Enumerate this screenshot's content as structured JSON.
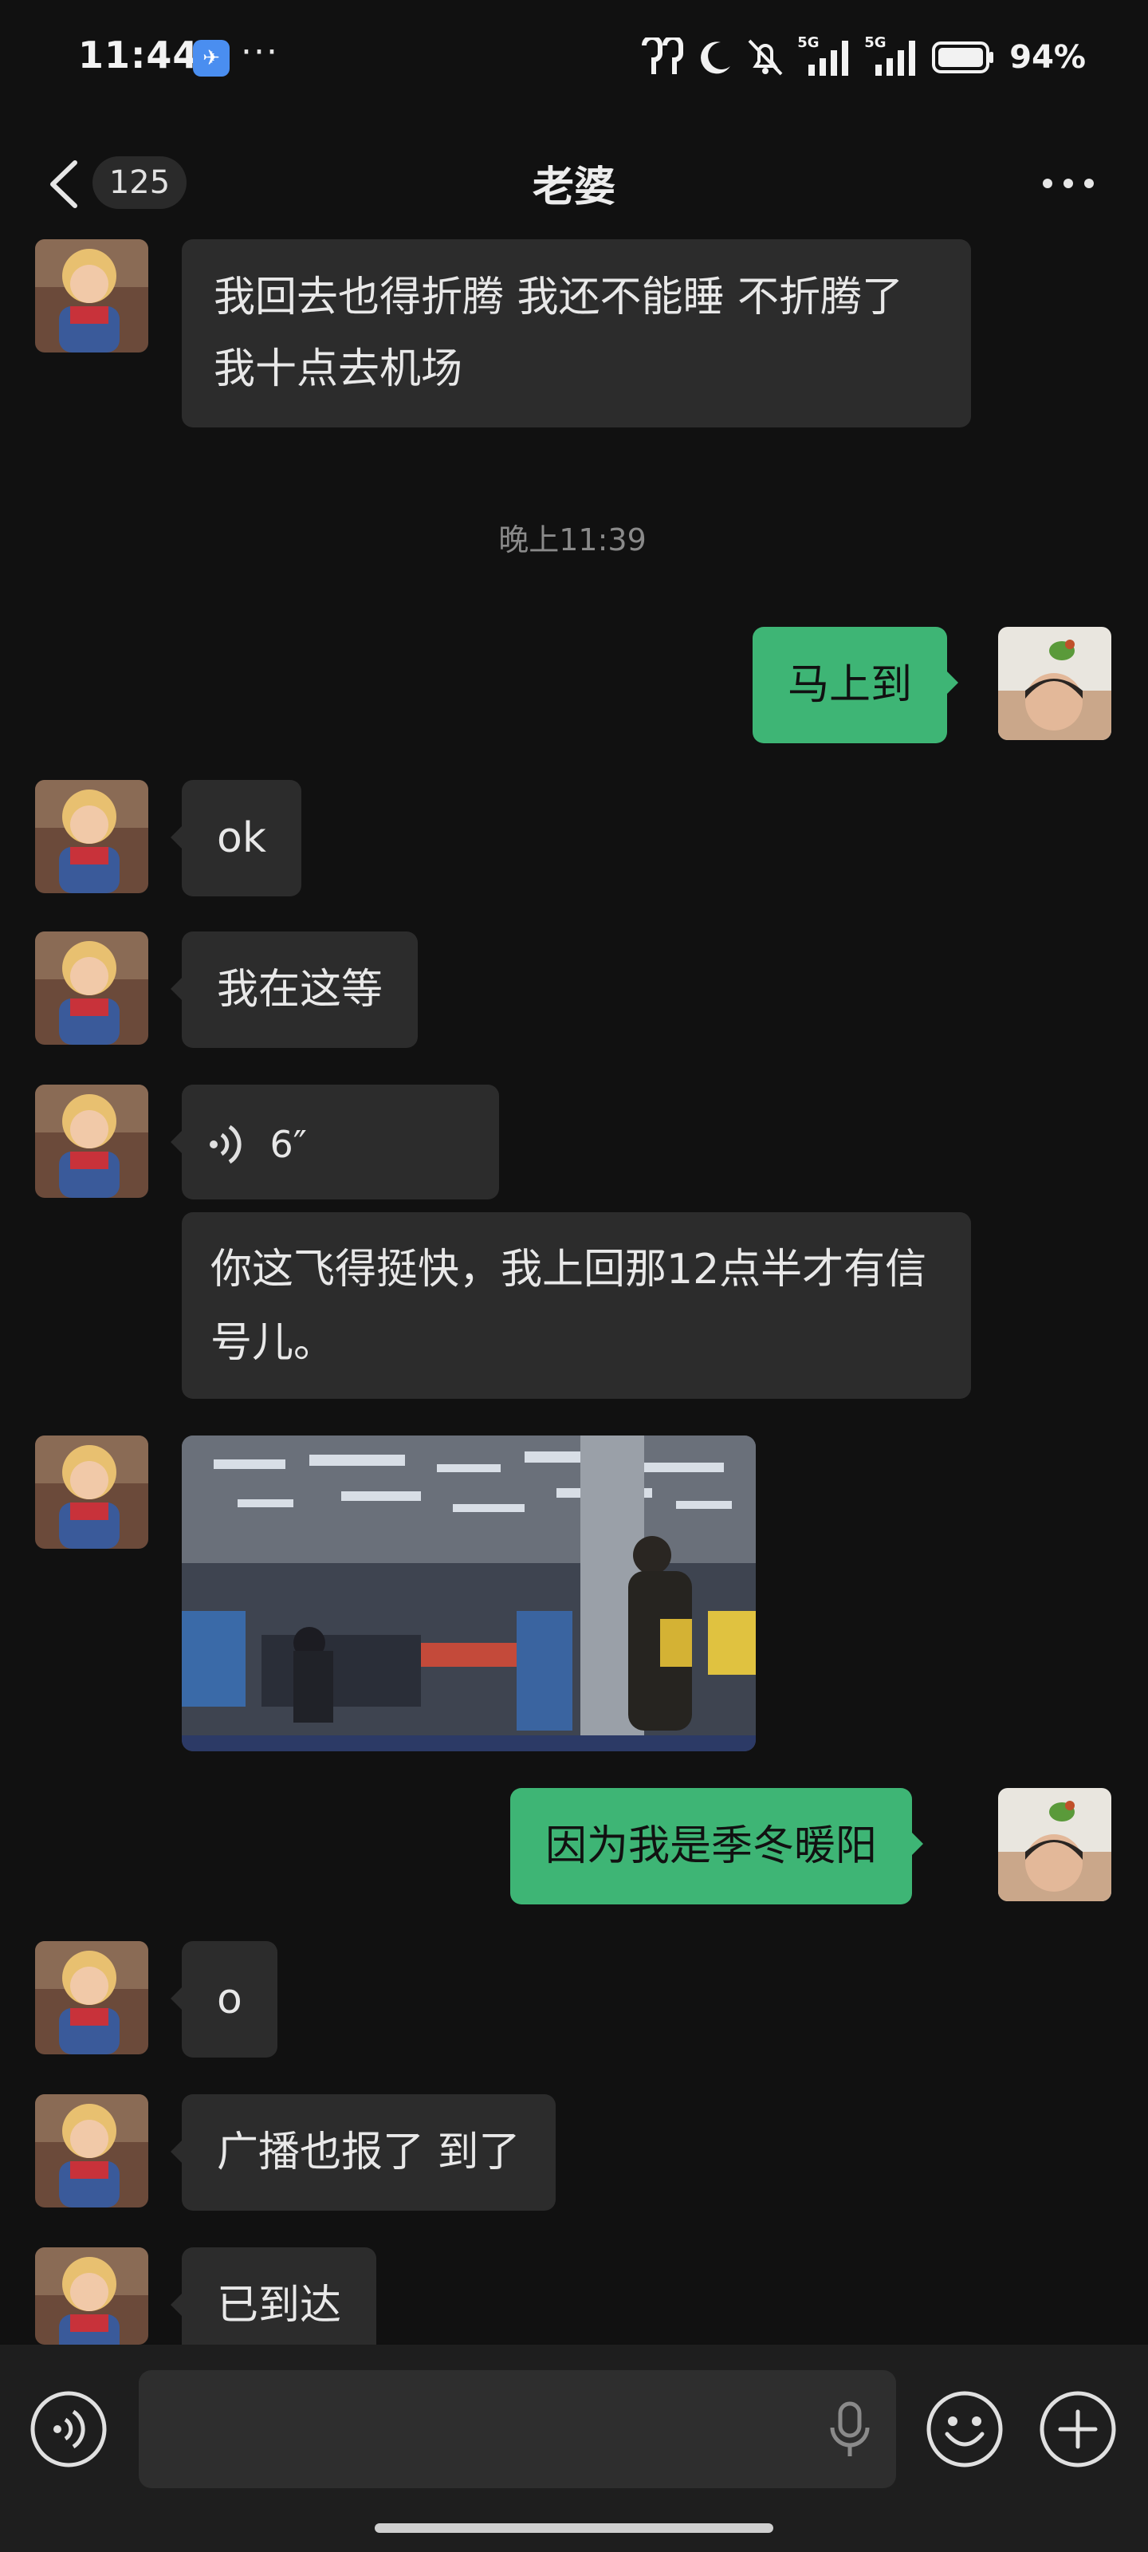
{
  "status_bar": {
    "time": "11:44",
    "more": "···",
    "signal_label_1": "5G",
    "signal_label_2": "5G",
    "battery": "94%"
  },
  "header": {
    "unread_count": "125",
    "title": "老婆"
  },
  "messages": {
    "m1": "我回去也得折腾 我还不能睡 不折腾了 我十点去机场",
    "time_divider": "晚上11:39",
    "m2": "马上到",
    "m3": "ok",
    "m4": "我在这等",
    "m5_voice_duration": "6″",
    "m6": "你这飞得挺快，我上回那12点半才有信号儿。",
    "m8": "因为我是季冬暖阳",
    "m9": "o",
    "m10": "广播也报了 到了",
    "m11": "已到达"
  },
  "colors": {
    "background": "#111111",
    "incoming_bubble": "#2c2c2c",
    "outgoing_bubble": "#3eb575",
    "input_bar": "#1e1e1e"
  }
}
